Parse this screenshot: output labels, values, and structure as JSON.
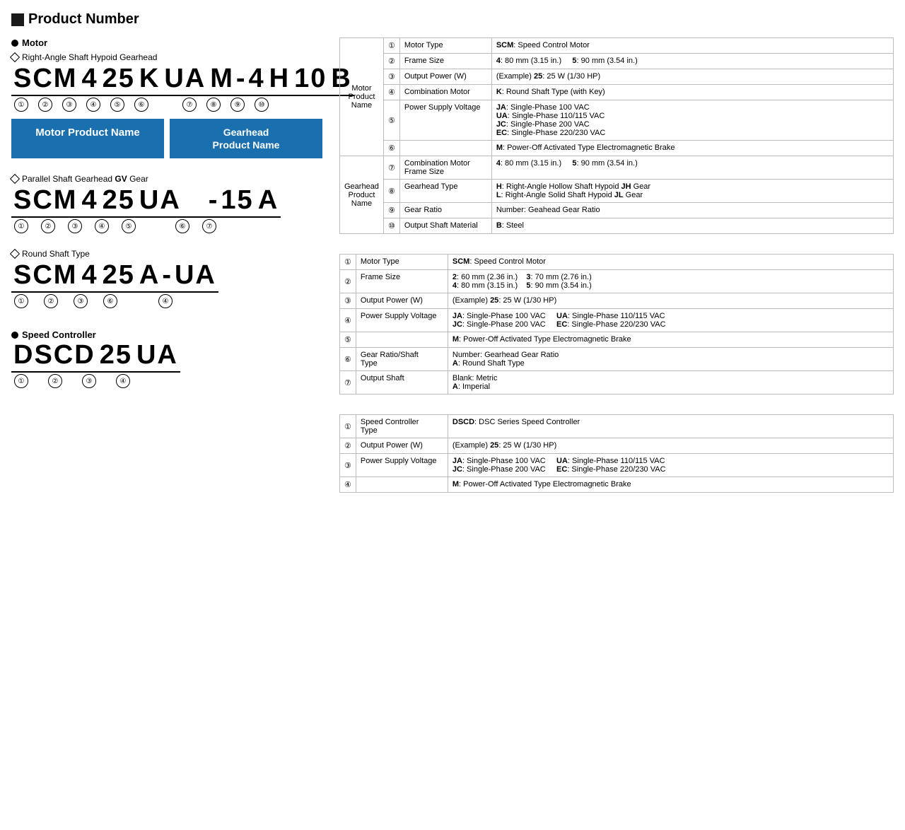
{
  "pageTitle": "Product Number",
  "motor": {
    "label": "Motor",
    "sections": [
      {
        "diamondLabel": "Right-Angle Shaft Hypoid Gearhead",
        "productNumber": [
          "SCM",
          "4",
          "25",
          "K",
          "UA",
          "M",
          "-",
          "4",
          "H",
          "10",
          "B"
        ],
        "circles": [
          "①",
          "②",
          "③",
          "④",
          "⑤",
          "⑥",
          "",
          "⑦",
          "⑧",
          "⑨",
          "⑩"
        ],
        "circleRow": [
          "①",
          "②",
          "③",
          "④",
          "⑤",
          "⑥",
          "⑦",
          "⑧",
          "⑨",
          "⑩"
        ],
        "nameBoxes": [
          {
            "label": "Motor Product Name"
          },
          {
            "label": "Gearhead\nProduct Name"
          }
        ]
      },
      {
        "diamondLabel": "Parallel Shaft Gearhead GV Gear",
        "productNumber": [
          "SCM",
          "4",
          "25",
          "UA",
          "",
          "-",
          "15",
          "A"
        ],
        "circleRow": [
          "①",
          "②",
          "③",
          "④",
          "⑤",
          "",
          "⑥",
          "⑦"
        ]
      },
      {
        "diamondLabel": "Round Shaft Type",
        "productNumber": [
          "SCM",
          "4",
          "25",
          "A",
          "-",
          "UA"
        ],
        "circleRow": [
          "①",
          "②",
          "③",
          "⑥",
          "",
          "④"
        ]
      }
    ]
  },
  "speedController": {
    "label": "Speed Controller",
    "productNumber": [
      "DSCD",
      "25",
      "UA"
    ],
    "circleRow": [
      "①",
      "②",
      "③",
      "④"
    ]
  },
  "rightAngleTable": {
    "motorProductName": "Motor\nProduct\nName",
    "gearheadProductName": "Gearhead\nProduct\nName",
    "rows": [
      {
        "circle": "①",
        "label": "Motor Type",
        "value": "<b>SCM</b>: Speed Control Motor",
        "rowspan": 1
      },
      {
        "circle": "②",
        "label": "Frame Size",
        "value": "<b>4</b>: 80 mm (3.15 in.)    <b>5</b>: 90 mm (3.54 in.)",
        "rowspan": 1
      },
      {
        "circle": "③",
        "label": "Output Power (W)",
        "value": "(Example) <b>25</b>: 25 W (1/30 HP)",
        "rowspan": 1
      },
      {
        "circle": "④",
        "label": "Combination Motor",
        "value": "<b>K</b>: Round Shaft Type (with Key)",
        "rowspan": 1
      },
      {
        "circle": "⑤",
        "label": "Power Supply Voltage",
        "value": "<b>JA</b>: Single-Phase 100 VAC\n<b>UA</b>: Single-Phase 110/115 VAC\n<b>JC</b>: Single-Phase 200 VAC\n<b>EC</b>: Single-Phase 220/230 VAC",
        "rowspan": 1
      },
      {
        "circle": "⑥",
        "label": "",
        "value": "<b>M</b>: Power-Off Activated Type Electromagnetic Brake",
        "rowspan": 1
      },
      {
        "circle": "⑦",
        "label": "Combination Motor\nFrame Size",
        "value": "<b>4</b>: 80 mm (3.15 in.)    <b>5</b>: 90 mm (3.54 in.)",
        "rowspan": 1
      },
      {
        "circle": "⑧",
        "label": "Gearhead Type",
        "value": "<b>H</b>: Right-Angle Hollow Shaft Hypoid <b>JH</b> Gear\n<b>L</b>: Right-Angle Solid Shaft Hypoid <b>JL</b> Gear",
        "rowspan": 1
      },
      {
        "circle": "⑨",
        "label": "Gear Ratio",
        "value": "Number: Geahead Gear Ratio",
        "rowspan": 1
      },
      {
        "circle": "⑩",
        "label": "Output Shaft Material",
        "value": "<b>B</b>: Steel",
        "rowspan": 1
      }
    ]
  },
  "parallelTable": {
    "rows": [
      {
        "circle": "①",
        "label": "Motor Type",
        "value": "<b>SCM</b>: Speed Control Motor"
      },
      {
        "circle": "②",
        "label": "Frame Size",
        "value": "<b>2</b>: 60 mm (2.36 in.)    <b>3</b>: 70 mm (2.76 in.)\n<b>4</b>: 80 mm (3.15 in.)    <b>5</b>: 90 mm (3.54 in.)"
      },
      {
        "circle": "③",
        "label": "Output Power (W)",
        "value": "(Example) <b>25</b>: 25 W (1/30 HP)"
      },
      {
        "circle": "④",
        "label": "Power Supply Voltage",
        "value": "<b>JA</b>: Single-Phase 100 VAC    <b>UA</b>: Single-Phase 110/115 VAC\n<b>JC</b>: Single-Phase 200 VAC    <b>EC</b>: Single-Phase 220/230 VAC"
      },
      {
        "circle": "⑤",
        "label": "",
        "value": "<b>M</b>: Power-Off Activated Type Electromagnetic Brake"
      },
      {
        "circle": "⑥",
        "label": "Gear Ratio/Shaft\nType",
        "value": "Number: Gearhead Gear Ratio\n<b>A</b>: Round Shaft Type"
      },
      {
        "circle": "⑦",
        "label": "Output Shaft",
        "value": "Blank: Metric\n<b>A</b>: Imperial"
      }
    ]
  },
  "speedControllerTable": {
    "rows": [
      {
        "circle": "①",
        "label": "Speed Controller\nType",
        "value": "<b>DSCD</b>: DSC Series Speed Controller"
      },
      {
        "circle": "②",
        "label": "Output Power (W)",
        "value": "(Example) <b>25</b>: 25 W (1/30 HP)"
      },
      {
        "circle": "③",
        "label": "Power Supply Voltage",
        "value": "<b>JA</b>: Single-Phase 100 VAC    <b>UA</b>: Single-Phase 110/115 VAC\n<b>JC</b>: Single-Phase 200 VAC    <b>EC</b>: Single-Phase 220/230 VAC"
      },
      {
        "circle": "④",
        "label": "",
        "value": "<b>M</b>: Power-Off Activated Type Electromagnetic Brake"
      }
    ]
  }
}
